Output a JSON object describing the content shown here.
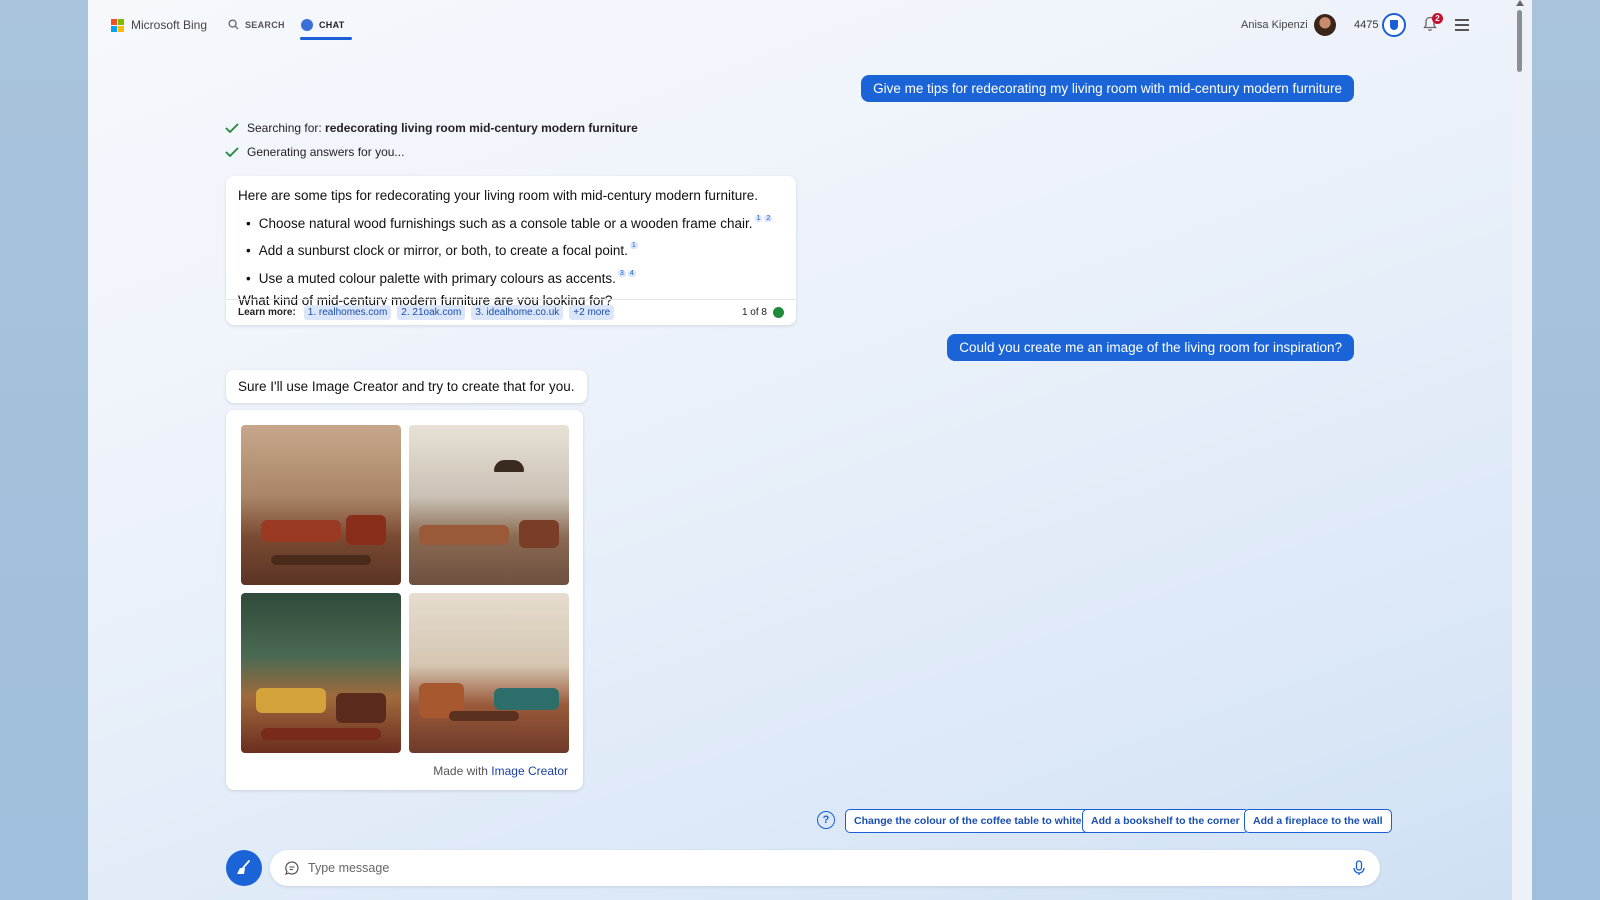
{
  "header": {
    "logo_text": "Microsoft Bing",
    "tabs": [
      {
        "label": "SEARCH"
      },
      {
        "label": "CHAT"
      }
    ],
    "user_name": "Anisa Kipenzi",
    "points": "4475",
    "notification_count": "2"
  },
  "colors": {
    "accent": "#1b64d8",
    "chip_bg": "#dbe6fb",
    "status_green": "#1f8a3b"
  },
  "conversation": {
    "user_message_1": "Give me tips for redecorating my living room with mid-century modern furniture",
    "status_1_prefix": "Searching for: ",
    "status_1_query": "redecorating living room mid-century modern furniture",
    "status_2": "Generating answers for you...",
    "response": {
      "intro": "Here are some tips for redecorating your living room with mid-century modern furniture.",
      "tips": [
        {
          "text": "Choose natural wood furnishings such as a console table or a wooden frame chair.",
          "refs": [
            "1",
            "2"
          ]
        },
        {
          "text": "Add a sunburst clock or mirror, or both, to create a focal point.",
          "refs": [
            "1"
          ]
        },
        {
          "text": "Use a muted colour palette with primary colours as accents.",
          "refs": [
            "3",
            "4"
          ]
        }
      ],
      "question": "What kind of mid-century modern furniture are you looking for?",
      "learn_more_label": "Learn more:",
      "sources": [
        "1. realhomes.com",
        "2. 21oak.com",
        "3. idealhome.co.uk",
        "+2 more"
      ],
      "pager": "1 of 8"
    },
    "user_message_2": "Could you create me an image of the living room for inspiration?",
    "bot_message_2": "Sure I'll use Image Creator and try to create that for you.",
    "made_with_prefix": "Made with ",
    "made_with_link": "Image Creator"
  },
  "suggestions": [
    "Change the colour of the coffee table to white",
    "Add a bookshelf to the corner",
    "Add a fireplace to the wall"
  ],
  "input": {
    "placeholder": "Type message"
  }
}
